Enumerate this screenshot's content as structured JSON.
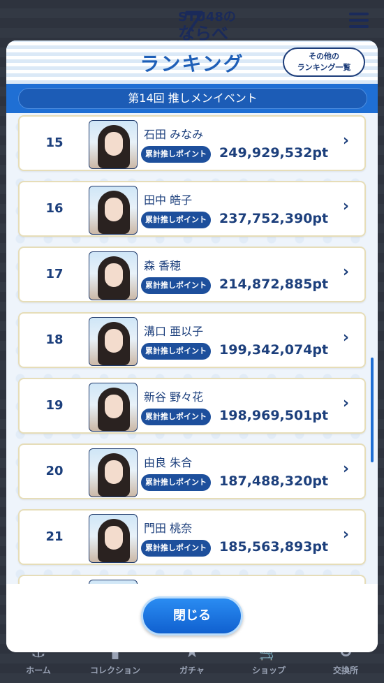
{
  "app": {
    "logo_seven": "7",
    "logo_stu": "STU48の",
    "logo_nara": "ならべ"
  },
  "modal": {
    "title": "ランキング",
    "other_rankings_line1": "その他の",
    "other_rankings_line2": "ランキング一覧",
    "event_name": "第14回 推しメンイベント",
    "badge_label": "累計推しポイント",
    "chevron": "›",
    "close_label": "閉じる"
  },
  "rankings": [
    {
      "rank": "15",
      "name": "石田 みなみ",
      "points": "249,929,532pt"
    },
    {
      "rank": "16",
      "name": "田中 皓子",
      "points": "237,752,390pt"
    },
    {
      "rank": "17",
      "name": "森 香穂",
      "points": "214,872,885pt"
    },
    {
      "rank": "18",
      "name": "溝口 亜以子",
      "points": "199,342,074pt"
    },
    {
      "rank": "19",
      "name": "新谷 野々花",
      "points": "198,969,501pt"
    },
    {
      "rank": "20",
      "name": "由良 朱合",
      "points": "187,488,320pt"
    },
    {
      "rank": "21",
      "name": "門田 桃奈",
      "points": "185,563,893pt"
    }
  ],
  "bottom_nav": [
    {
      "label": "ホーム",
      "icon": "anchor-icon"
    },
    {
      "label": "コレクション",
      "icon": "collection-icon"
    },
    {
      "label": "ガチャ",
      "icon": "gacha-icon"
    },
    {
      "label": "ショップ",
      "icon": "cart-icon"
    },
    {
      "label": "交換所",
      "icon": "exchange-icon"
    }
  ]
}
